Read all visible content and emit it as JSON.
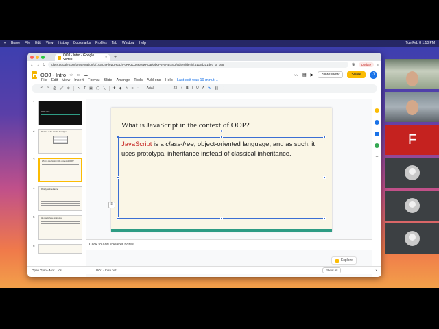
{
  "menubar": {
    "items": [
      "Brave",
      "File",
      "Edit",
      "View",
      "History",
      "Bookmarks",
      "Profiles",
      "Tab",
      "Window",
      "Help"
    ],
    "clock": "Tue Feb 8  1:10 PM"
  },
  "browser": {
    "tab_title": "OOJ - Intro - Google Slides",
    "tab_close": "×",
    "new_tab": "+",
    "url": "docs.google.com/presentation/d/1ASO4Hl6vQRGLhi-cRK3QJ6Rv6wRDBiOb0P6yoNEoSU/edit#slide=id.g113d2d1de7_0_166",
    "update_label": "Update"
  },
  "app": {
    "title": "OOJ - Intro",
    "menu": [
      "File",
      "Edit",
      "View",
      "Insert",
      "Format",
      "Slide",
      "Arrange",
      "Tools",
      "Add-ons",
      "Help"
    ],
    "last_edit": "Last edit was 19 minut…",
    "slideshow_label": "Slideshow",
    "share_label": "Share",
    "user_initial": "J",
    "toolbar": {
      "font_name": "Arial",
      "font_size": "23"
    }
  },
  "filmstrip": {
    "slides": [
      {
        "num": "1",
        "text": "OOJ • Intro"
      },
      {
        "num": "2",
        "text": "Runtime of the JS ES6 Prototypes"
      },
      {
        "num": "3",
        "text": "What is JavaScript in the context of OOP?"
      },
      {
        "num": "4",
        "text": "Prototypal Inheritance"
      },
      {
        "num": "5",
        "text": "All objects have prototypes"
      },
      {
        "num": "6",
        "text": ""
      }
    ]
  },
  "slide": {
    "title": "What is JavaScript in the context of OOP?",
    "body_link": "JavaScript",
    "body_part1": " is a ",
    "body_italic": "class-free",
    "body_part2": ", object-oriented language, and as such, it uses prototypal inheritance instead of classical inheritance."
  },
  "notes_placeholder": "Click to add speaker notes",
  "explore_label": "Explore",
  "downloads": {
    "items": [
      "Open Gym - Mor....ics",
      "OOJ - Intro.pdf"
    ],
    "show_all": "Show All"
  },
  "participants": {
    "letter_tile": "F"
  }
}
